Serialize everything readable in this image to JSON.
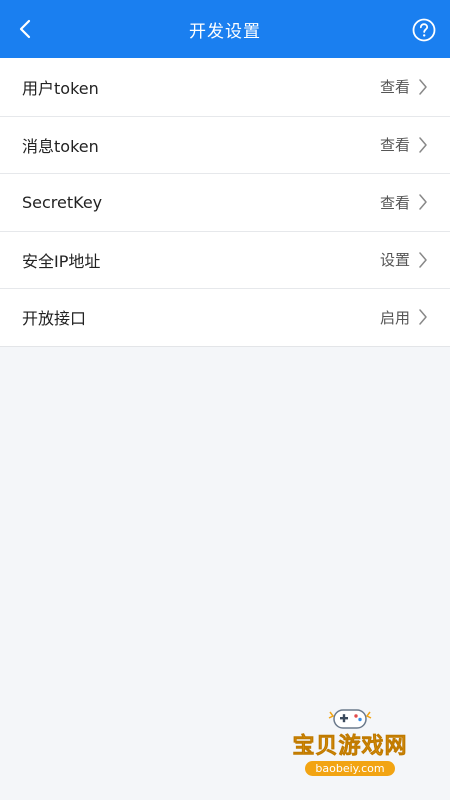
{
  "header": {
    "title": "开发设置",
    "back_icon": "chevron-left-icon",
    "help_icon": "question-circle-icon",
    "color": "#1a7ff0"
  },
  "settings": [
    {
      "label": "用户token",
      "action": "查看"
    },
    {
      "label": "消息token",
      "action": "查看"
    },
    {
      "label": "SecretKey",
      "action": "查看"
    },
    {
      "label": "安全IP地址",
      "action": "设置"
    },
    {
      "label": "开放接口",
      "action": "启用"
    }
  ],
  "watermark": {
    "text": "宝贝游戏网",
    "url": "baobeiy.com"
  }
}
